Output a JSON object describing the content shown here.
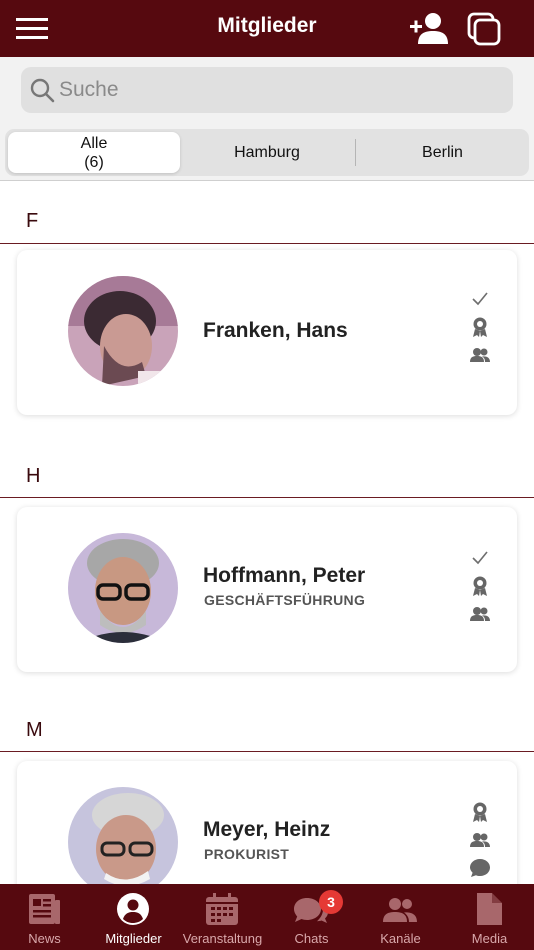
{
  "header": {
    "title": "Mitglieder",
    "menu_icon": "hamburger-menu-icon",
    "add_icon": "add-user-icon",
    "copy_icon": "copy-icon"
  },
  "search": {
    "placeholder": "Suche",
    "value": ""
  },
  "segments": [
    {
      "label": "Alle",
      "count": "(6)",
      "active": true
    },
    {
      "label": "Hamburg",
      "active": false
    },
    {
      "label": "Berlin",
      "active": false
    }
  ],
  "sections": [
    {
      "letter": "F",
      "members": [
        {
          "name": "Franken, Hans",
          "role": "",
          "icons": [
            "check-icon",
            "award-icon",
            "group-icon"
          ]
        }
      ]
    },
    {
      "letter": "H",
      "members": [
        {
          "name": "Hoffmann, Peter",
          "role": "GESCHÄFTSFÜHRUNG",
          "icons": [
            "check-icon",
            "award-icon",
            "group-icon"
          ]
        }
      ]
    },
    {
      "letter": "M",
      "members": [
        {
          "name": "Meyer, Heinz",
          "role": "PROKURIST",
          "icons": [
            "award-icon",
            "group-icon",
            "chat-icon"
          ]
        }
      ]
    }
  ],
  "bottom_nav": [
    {
      "label": "News",
      "icon": "news-icon",
      "active": false
    },
    {
      "label": "Mitglieder",
      "icon": "account-icon",
      "active": true
    },
    {
      "label": "Veranstaltung",
      "icon": "calendar-icon",
      "active": false
    },
    {
      "label": "Chats",
      "icon": "chats-icon",
      "active": false,
      "badge": "3"
    },
    {
      "label": "Kanäle",
      "icon": "channels-icon",
      "active": false
    },
    {
      "label": "Media",
      "icon": "media-icon",
      "active": false
    }
  ],
  "colors": {
    "primary": "#56090f",
    "nav_inactive_text": "#d9a8ab",
    "badge": "#e53935"
  }
}
